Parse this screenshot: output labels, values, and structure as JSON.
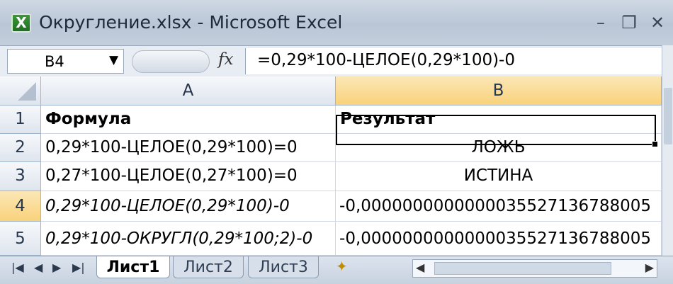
{
  "window": {
    "title": "Округление.xlsx - Microsoft Excel",
    "icon": "excel-icon",
    "controls": [
      "minimize-icon",
      "restore-icon",
      "close-icon"
    ]
  },
  "formula_bar": {
    "name_box": "B4",
    "fx_label": "fx",
    "formula": "=0,29*100-ЦЕЛОЕ(0,29*100)-0"
  },
  "grid": {
    "columns": [
      "A",
      "B"
    ],
    "active_column": "B",
    "active_row": "4",
    "rows": [
      {
        "num": "1",
        "a": "Формула",
        "b": "Результат"
      },
      {
        "num": "2",
        "a": "0,29*100-ЦЕЛОЕ(0,29*100)=0",
        "b": "ЛОЖЬ"
      },
      {
        "num": "3",
        "a": "0,27*100-ЦЕЛОЕ(0,27*100)=0",
        "b": "ИСТИНА"
      },
      {
        "num": "4",
        "a": "0,29*100-ЦЕЛОЕ(0,29*100)-0",
        "b": "-0,0000000000000035527136788005"
      },
      {
        "num": "5",
        "a": "0,29*100-ОКРУГЛ(0,29*100;2)-0",
        "b": "-0,0000000000000035527136788005"
      }
    ]
  },
  "sheets": {
    "tabs": [
      "Лист1",
      "Лист2",
      "Лист3"
    ],
    "active": "Лист1"
  }
}
